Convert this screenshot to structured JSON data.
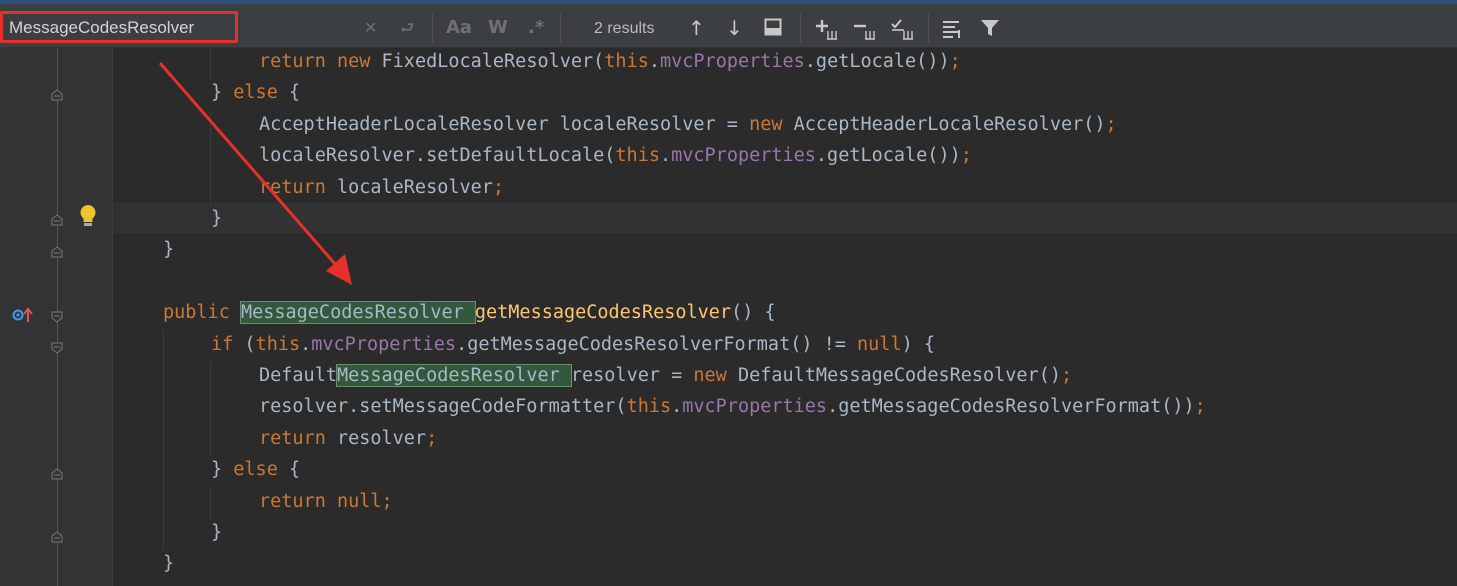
{
  "find_bar": {
    "query": "MessageCodesResolver",
    "results": "2 results",
    "match_case_label": "Aa",
    "words_label": "W",
    "regex_label": ".*"
  },
  "code_lines": [
    {
      "parts": [
        [
          "kw",
          "return new "
        ],
        [
          "",
          "FixedLocaleResolver("
        ],
        [
          "kw",
          "this"
        ],
        [
          "",
          "."
        ],
        [
          "fld",
          "mvcProperties"
        ],
        [
          "",
          ".getLocale())"
        ],
        [
          "kw",
          ";"
        ]
      ]
    },
    {
      "parts": [
        [
          "",
          "} "
        ],
        [
          "kw",
          "else"
        ],
        [
          "",
          " {"
        ]
      ]
    },
    {
      "parts": [
        [
          "",
          "AcceptHeaderLocaleResolver localeResolver = "
        ],
        [
          "kw",
          "new "
        ],
        [
          "",
          "AcceptHeaderLocaleResolver()"
        ],
        [
          "kw",
          ";"
        ]
      ]
    },
    {
      "parts": [
        [
          "",
          "localeResolver.setDefaultLocale("
        ],
        [
          "kw",
          "this"
        ],
        [
          "",
          "."
        ],
        [
          "fld",
          "mvcProperties"
        ],
        [
          "",
          ".getLocale())"
        ],
        [
          "kw",
          ";"
        ]
      ]
    },
    {
      "parts": [
        [
          "kw",
          "return "
        ],
        [
          "",
          "localeResolver"
        ],
        [
          "kw",
          ";"
        ]
      ]
    },
    {
      "parts": [
        [
          "",
          "}"
        ]
      ]
    },
    {
      "parts": [
        [
          "",
          "}"
        ]
      ]
    },
    {
      "parts": []
    },
    {
      "parts": [
        [
          "kw",
          "public "
        ],
        [
          "hl",
          "MessageCodesResolver "
        ],
        [
          "fn",
          "getMessageCodesResolver"
        ],
        [
          "",
          "() {"
        ]
      ]
    },
    {
      "parts": [
        [
          "kw",
          "if "
        ],
        [
          "",
          "("
        ],
        [
          "kw",
          "this"
        ],
        [
          "",
          "."
        ],
        [
          "fld",
          "mvcProperties"
        ],
        [
          "",
          ".getMessageCodesResolverFormat() != "
        ],
        [
          "kw",
          "null"
        ],
        [
          "",
          ") {"
        ]
      ]
    },
    {
      "parts": [
        [
          "",
          "Default"
        ],
        [
          "hl",
          "MessageCodesResolver "
        ],
        [
          "",
          "resolver = "
        ],
        [
          "kw",
          "new "
        ],
        [
          "",
          "DefaultMessageCodesResolver()"
        ],
        [
          "kw",
          ";"
        ]
      ]
    },
    {
      "parts": [
        [
          "",
          "resolver.setMessageCodeFormatter("
        ],
        [
          "kw",
          "this"
        ],
        [
          "",
          "."
        ],
        [
          "fld",
          "mvcProperties"
        ],
        [
          "",
          ".getMessageCodesResolverFormat())"
        ],
        [
          "kw",
          ";"
        ]
      ]
    },
    {
      "parts": [
        [
          "kw",
          "return "
        ],
        [
          "",
          "resolver"
        ],
        [
          "kw",
          ";"
        ]
      ]
    },
    {
      "parts": [
        [
          "",
          "} "
        ],
        [
          "kw",
          "else"
        ],
        [
          "",
          " {"
        ]
      ]
    },
    {
      "parts": [
        [
          "kw",
          "return null;"
        ]
      ]
    },
    {
      "parts": [
        [
          "",
          "}"
        ]
      ]
    },
    {
      "parts": [
        [
          "",
          "}"
        ]
      ]
    }
  ],
  "colors": {
    "keyword": "#cc7832",
    "field": "#9876aa",
    "method": "#ffc66d",
    "text": "#a9b7c6",
    "search_highlight": "#32593d",
    "annotation_red": "#e8302a"
  }
}
